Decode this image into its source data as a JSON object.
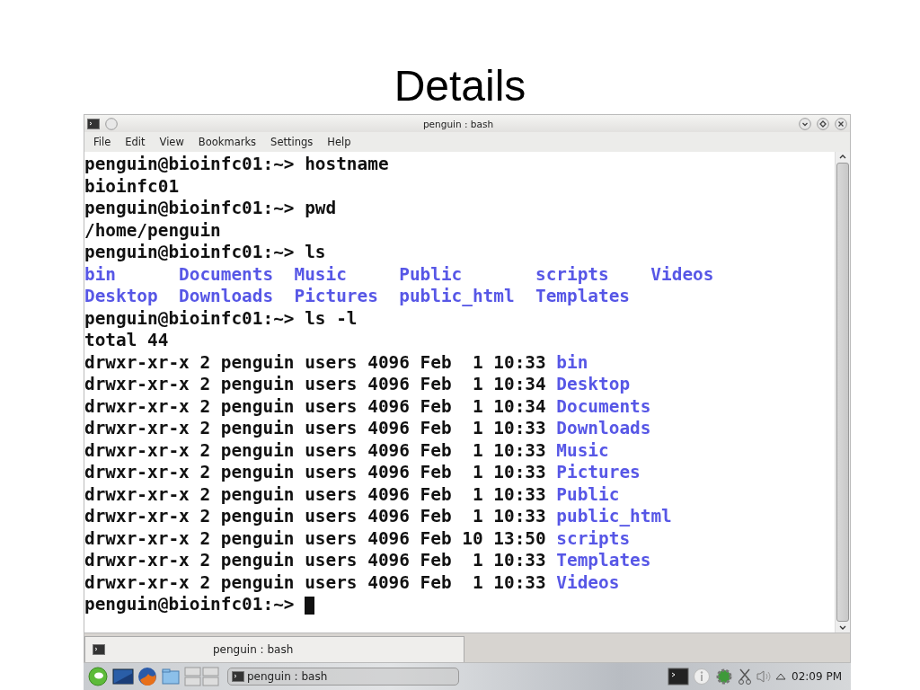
{
  "slide": {
    "title": "Details"
  },
  "window": {
    "title": "penguin : bash"
  },
  "menu": [
    "File",
    "Edit",
    "View",
    "Bookmarks",
    "Settings",
    "Help"
  ],
  "terminal": {
    "lines": [
      {
        "kind": "plain",
        "segments": [
          {
            "kind": "plain",
            "text": "penguin@bioinfc01:~> hostname"
          }
        ]
      },
      {
        "kind": "plain",
        "segments": [
          {
            "kind": "plain",
            "text": "bioinfc01"
          }
        ]
      },
      {
        "kind": "plain",
        "segments": [
          {
            "kind": "plain",
            "text": "penguin@bioinfc01:~> pwd"
          }
        ]
      },
      {
        "kind": "plain",
        "segments": [
          {
            "kind": "plain",
            "text": "/home/penguin"
          }
        ]
      },
      {
        "kind": "plain",
        "segments": [
          {
            "kind": "plain",
            "text": "penguin@bioinfc01:~> ls"
          }
        ]
      },
      {
        "kind": "columns",
        "segments": [
          {
            "kind": "dir",
            "text": "bin"
          },
          {
            "kind": "dir",
            "text": "Documents"
          },
          {
            "kind": "dir",
            "text": "Music"
          },
          {
            "kind": "dir",
            "text": "Public"
          },
          {
            "kind": "dir",
            "text": "scripts"
          },
          {
            "kind": "dir",
            "text": "Videos"
          }
        ]
      },
      {
        "kind": "columns",
        "segments": [
          {
            "kind": "dir",
            "text": "Desktop"
          },
          {
            "kind": "dir",
            "text": "Downloads"
          },
          {
            "kind": "dir",
            "text": "Pictures"
          },
          {
            "kind": "dir",
            "text": "public_html"
          },
          {
            "kind": "dir",
            "text": "Templates"
          }
        ]
      },
      {
        "kind": "plain",
        "segments": [
          {
            "kind": "plain",
            "text": "penguin@bioinfc01:~> ls -l"
          }
        ]
      },
      {
        "kind": "plain",
        "segments": [
          {
            "kind": "plain",
            "text": "total 44"
          }
        ]
      },
      {
        "kind": "plain",
        "segments": [
          {
            "kind": "plain",
            "text": "drwxr-xr-x 2 penguin users 4096 Feb  1 10:33"
          },
          {
            "kind": "dir",
            "text": "bin"
          }
        ]
      },
      {
        "kind": "plain",
        "segments": [
          {
            "kind": "plain",
            "text": "drwxr-xr-x 2 penguin users 4096 Feb  1 10:34"
          },
          {
            "kind": "dir",
            "text": "Desktop"
          }
        ]
      },
      {
        "kind": "plain",
        "segments": [
          {
            "kind": "plain",
            "text": "drwxr-xr-x 2 penguin users 4096 Feb  1 10:34"
          },
          {
            "kind": "dir",
            "text": "Documents"
          }
        ]
      },
      {
        "kind": "plain",
        "segments": [
          {
            "kind": "plain",
            "text": "drwxr-xr-x 2 penguin users 4096 Feb  1 10:33"
          },
          {
            "kind": "dir",
            "text": "Downloads"
          }
        ]
      },
      {
        "kind": "plain",
        "segments": [
          {
            "kind": "plain",
            "text": "drwxr-xr-x 2 penguin users 4096 Feb  1 10:33"
          },
          {
            "kind": "dir",
            "text": "Music"
          }
        ]
      },
      {
        "kind": "plain",
        "segments": [
          {
            "kind": "plain",
            "text": "drwxr-xr-x 2 penguin users 4096 Feb  1 10:33"
          },
          {
            "kind": "dir",
            "text": "Pictures"
          }
        ]
      },
      {
        "kind": "plain",
        "segments": [
          {
            "kind": "plain",
            "text": "drwxr-xr-x 2 penguin users 4096 Feb  1 10:33"
          },
          {
            "kind": "dir",
            "text": "Public"
          }
        ]
      },
      {
        "kind": "plain",
        "segments": [
          {
            "kind": "plain",
            "text": "drwxr-xr-x 2 penguin users 4096 Feb  1 10:33"
          },
          {
            "kind": "dir",
            "text": "public_html"
          }
        ]
      },
      {
        "kind": "plain",
        "segments": [
          {
            "kind": "plain",
            "text": "drwxr-xr-x 2 penguin users 4096 Feb 10 13:50"
          },
          {
            "kind": "dir",
            "text": "scripts"
          }
        ]
      },
      {
        "kind": "plain",
        "segments": [
          {
            "kind": "plain",
            "text": "drwxr-xr-x 2 penguin users 4096 Feb  1 10:33"
          },
          {
            "kind": "dir",
            "text": "Templates"
          }
        ]
      },
      {
        "kind": "plain",
        "segments": [
          {
            "kind": "plain",
            "text": "drwxr-xr-x 2 penguin users 4096 Feb  1 10:33"
          },
          {
            "kind": "dir",
            "text": "Videos"
          }
        ]
      },
      {
        "kind": "prompt",
        "segments": [
          {
            "kind": "plain",
            "text": "penguin@bioinfc01:~>"
          }
        ]
      }
    ]
  },
  "session_tabs": [
    {
      "label": "penguin : bash",
      "selected": true
    }
  ],
  "taskbar": {
    "tasks": [
      {
        "label": "penguin : bash"
      }
    ],
    "clock": "02:09 PM"
  }
}
